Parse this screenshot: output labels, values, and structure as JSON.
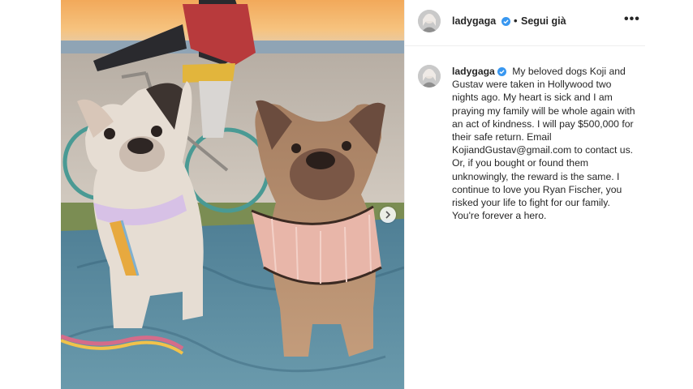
{
  "post": {
    "username": "ladygaga",
    "follow_status": "Segui già",
    "separator": "•",
    "more_icon": "more-options-icon",
    "verified_color": "#3897f0",
    "caption": "My beloved dogs Koji and Gustav were taken in Hollywood two nights ago. My heart is sick and I am praying my family will be whole again with an act of kindness. I will pay $500,000 for their safe return. Email KojiandGustav@gmail.com to contact us. Or, if you bought or found them unknowingly, the reward is the same. I continue to love you Ryan Fischer, you risked your life to fight for our family. You're forever a hero."
  },
  "media": {
    "next_icon": "chevron-right-icon"
  }
}
